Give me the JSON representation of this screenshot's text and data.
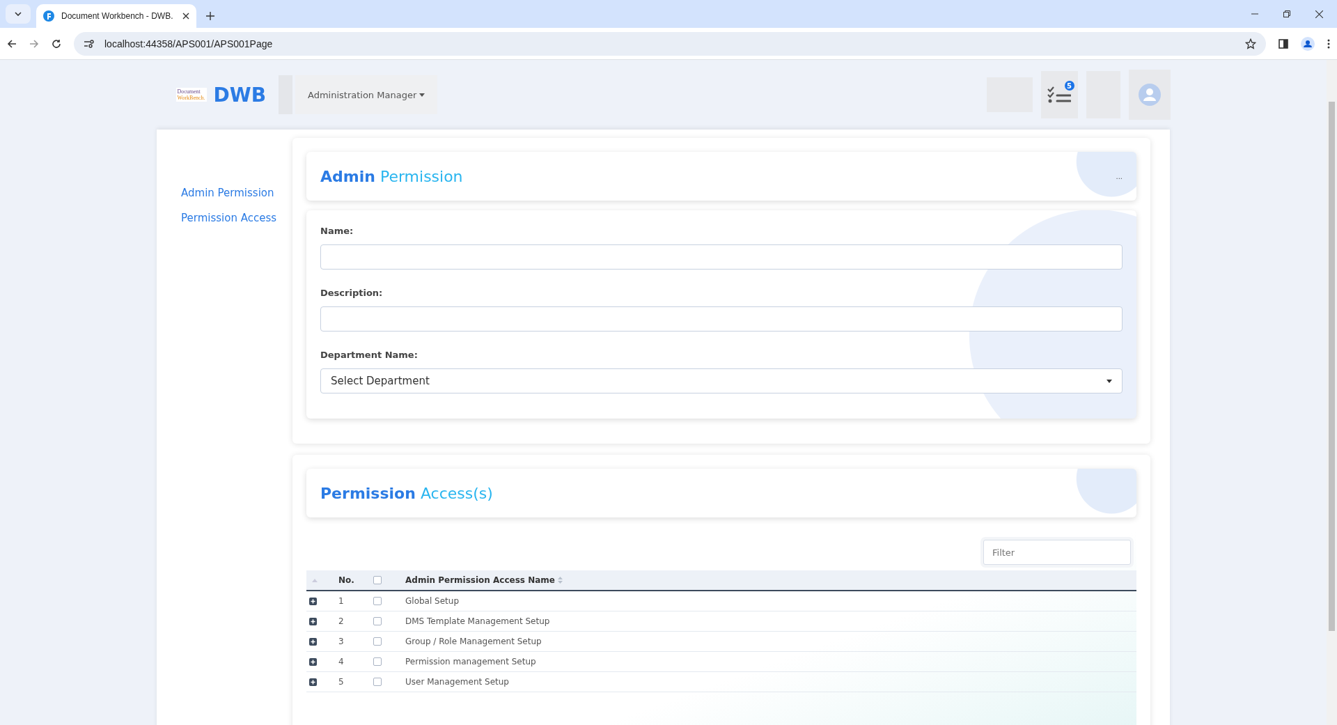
{
  "browser": {
    "tab_title": "Document Workbench - DWB.",
    "url": "localhost:44358/APS001/APS001Page"
  },
  "header": {
    "logo_line1": "Document",
    "logo_line2": "WorkBench.",
    "brand": "DWB",
    "menu": "Administration Manager",
    "task_count": "5"
  },
  "sidebar": {
    "items": [
      {
        "label": "Admin Permission",
        "selected": false
      },
      {
        "label": "Permission Access",
        "selected": false
      }
    ]
  },
  "admin_panel": {
    "title_bold": "Admin",
    "title_light": "Permission",
    "more": "...",
    "fields": [
      {
        "kind": "text",
        "label": "Name:"
      },
      {
        "kind": "text",
        "label": "Description:"
      },
      {
        "kind": "select",
        "label": "Department Name:",
        "value": "Select Department"
      }
    ]
  },
  "access_panel": {
    "title_bold": "Permission",
    "title_light": "Access(s)",
    "filter": {
      "placeholder": "Filter"
    },
    "table": {
      "columns": [
        "No.",
        "Admin Permission Access Name"
      ],
      "all_checked": false,
      "rows": [
        {
          "no": "1",
          "name": "Global Setup",
          "checked": false
        },
        {
          "no": "2",
          "name": "DMS Template Management Setup",
          "checked": false
        },
        {
          "no": "3",
          "name": "Group / Role Management Setup",
          "checked": false
        },
        {
          "no": "4",
          "name": "Permission management Setup",
          "checked": false
        },
        {
          "no": "5",
          "name": "User Management Setup",
          "checked": false
        }
      ]
    }
  }
}
